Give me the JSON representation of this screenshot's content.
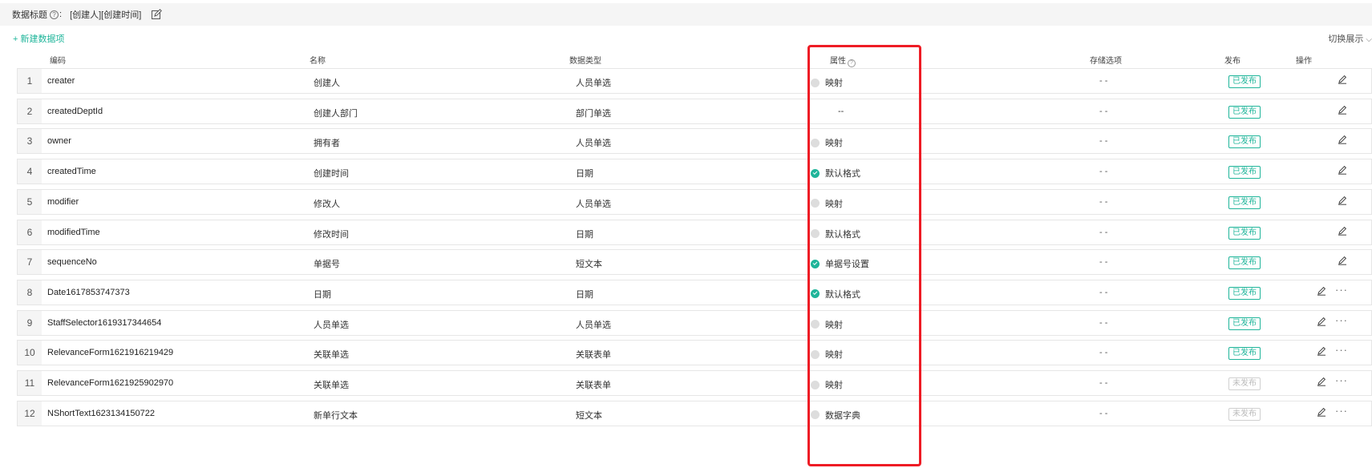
{
  "topbar": {
    "label": "数据标题",
    "help_glyph": "?",
    "colon": ":",
    "title_value": "[创建人][创建时间]"
  },
  "toolbar": {
    "new_item": "+ 新建数据项",
    "switch_view": "切换展示",
    "switch_chevron": "⌵"
  },
  "columns": {
    "code": "编码",
    "name": "名称",
    "data_type": "数据类型",
    "attribute": "属性",
    "storage": "存储选项",
    "publish": "发布",
    "actions": "操作"
  },
  "rows": [
    {
      "index": "1",
      "code": "creater",
      "name": "创建人",
      "data_type": "人员单选",
      "attr": "映射",
      "attr_state": "off",
      "storage": "- -",
      "publish": "已发布",
      "published": true,
      "more": false
    },
    {
      "index": "2",
      "code": "createdDeptId",
      "name": "创建人部门",
      "data_type": "部门单选",
      "attr": "--",
      "attr_state": "none",
      "storage": "- -",
      "publish": "已发布",
      "published": true,
      "more": false
    },
    {
      "index": "3",
      "code": "owner",
      "name": "拥有者",
      "data_type": "人员单选",
      "attr": "映射",
      "attr_state": "off",
      "storage": "- -",
      "publish": "已发布",
      "published": true,
      "more": false
    },
    {
      "index": "4",
      "code": "createdTime",
      "name": "创建时间",
      "data_type": "日期",
      "attr": "默认格式",
      "attr_state": "on",
      "storage": "- -",
      "publish": "已发布",
      "published": true,
      "more": false
    },
    {
      "index": "5",
      "code": "modifier",
      "name": "修改人",
      "data_type": "人员单选",
      "attr": "映射",
      "attr_state": "off",
      "storage": "- -",
      "publish": "已发布",
      "published": true,
      "more": false
    },
    {
      "index": "6",
      "code": "modifiedTime",
      "name": "修改时间",
      "data_type": "日期",
      "attr": "默认格式",
      "attr_state": "off",
      "storage": "- -",
      "publish": "已发布",
      "published": true,
      "more": false
    },
    {
      "index": "7",
      "code": "sequenceNo",
      "name": "单据号",
      "data_type": "短文本",
      "attr": "单据号设置",
      "attr_state": "on",
      "storage": "- -",
      "publish": "已发布",
      "published": true,
      "more": false
    },
    {
      "index": "8",
      "code": "Date1617853747373",
      "name": "日期",
      "data_type": "日期",
      "attr": "默认格式",
      "attr_state": "on",
      "storage": "- -",
      "publish": "已发布",
      "published": true,
      "more": true
    },
    {
      "index": "9",
      "code": "StaffSelector1619317344654",
      "name": "人员单选",
      "data_type": "人员单选",
      "attr": "映射",
      "attr_state": "off",
      "storage": "- -",
      "publish": "已发布",
      "published": true,
      "more": true
    },
    {
      "index": "10",
      "code": "RelevanceForm1621916219429",
      "name": "关联单选",
      "data_type": "关联表单",
      "attr": "映射",
      "attr_state": "off",
      "storage": "- -",
      "publish": "已发布",
      "published": true,
      "more": true
    },
    {
      "index": "11",
      "code": "RelevanceForm1621925902970",
      "name": "关联单选",
      "data_type": "关联表单",
      "attr": "映射",
      "attr_state": "off",
      "storage": "- -",
      "publish": "未发布",
      "published": false,
      "more": true
    },
    {
      "index": "12",
      "code": "NShortText1623134150722",
      "name": "新单行文本",
      "data_type": "短文本",
      "attr": "数据字典",
      "attr_state": "off",
      "storage": "- -",
      "publish": "未发布",
      "published": false,
      "more": true
    }
  ],
  "more_glyph": "···",
  "colors": {
    "accent": "#1fb59a",
    "highlight": "#ee1c25",
    "off_dot": "#dddddd"
  },
  "icons": {
    "title_edit": "edit-icon",
    "row_edit": "pencil-icon",
    "row_more": "more-icon",
    "attr_help": "question-circle-icon"
  }
}
